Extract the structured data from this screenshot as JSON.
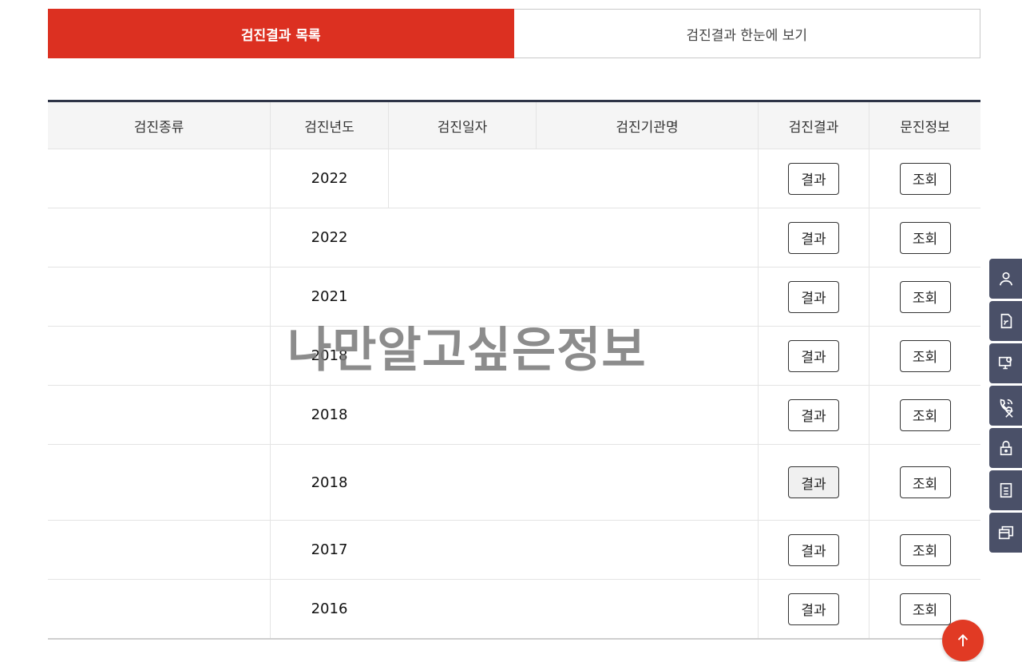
{
  "tabs": [
    {
      "label": "검진결과 목록",
      "active": true
    },
    {
      "label": "검진결과 한눈에 보기",
      "active": false
    }
  ],
  "table": {
    "headers": [
      "검진종류",
      "검진년도",
      "검진일자",
      "검진기관명",
      "검진결과",
      "문진정보"
    ],
    "rows": [
      {
        "year": "2022",
        "result_label": "결과",
        "survey_label": "조회"
      },
      {
        "year": "2022",
        "result_label": "결과",
        "survey_label": "조회"
      },
      {
        "year": "2021",
        "result_label": "결과",
        "survey_label": "조회"
      },
      {
        "year": "2018",
        "result_label": "결과",
        "survey_label": "조회"
      },
      {
        "year": "2018",
        "result_label": "결과",
        "survey_label": "조회"
      },
      {
        "year": "2018",
        "result_label": "결과",
        "survey_label": "조회"
      },
      {
        "year": "2017",
        "result_label": "결과",
        "survey_label": "조회"
      },
      {
        "year": "2016",
        "result_label": "결과",
        "survey_label": "조회"
      }
    ]
  },
  "watermark": "나만알고싶은정보",
  "side_menu": [
    "user-icon",
    "document-signal-icon",
    "monitor-icon",
    "phone-icon",
    "lock-icon",
    "list-icon",
    "windows-icon"
  ],
  "colors": {
    "accent": "#dc3021",
    "side": "#4a5068",
    "header_line": "#2e3447"
  }
}
